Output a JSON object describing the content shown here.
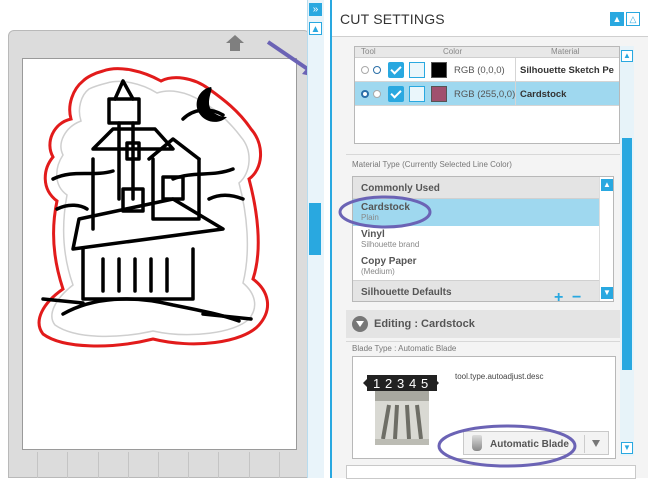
{
  "panel": {
    "title": "CUT SETTINGS",
    "icons": [
      "expand-icon",
      "collapse-icon"
    ]
  },
  "line_table": {
    "headers": {
      "tool": "Tool",
      "color": "Color",
      "material": "Material"
    },
    "rows": [
      {
        "rgb": "RGB (0,0,0)",
        "color": "#000000",
        "material": "Silhouette Sketch Pe",
        "selected": false
      },
      {
        "rgb": "RGB (255,0,0)",
        "color": "#a0506e",
        "material": "Cardstock",
        "selected": true
      }
    ]
  },
  "material_section": {
    "label": "Material Type (Currently Selected Line Color)",
    "groups": [
      {
        "title": "Commonly Used"
      }
    ],
    "items": [
      {
        "name": "Cardstock",
        "sub": "Plain",
        "selected": true
      },
      {
        "name": "Vinyl",
        "sub": "Silhouette brand",
        "selected": false
      },
      {
        "name": "Copy Paper",
        "sub": "(Medium)",
        "selected": false
      }
    ],
    "group2": "Silhouette Defaults",
    "add": "+",
    "remove": "−"
  },
  "editing": {
    "label": "Editing : Cardstock"
  },
  "blade": {
    "label": "Blade Type : Automatic Blade",
    "description": "tool.type.autoadjust.desc",
    "select_value": "Automatic Blade",
    "dial_numbers": [
      "1",
      "2",
      "3",
      "4",
      "5"
    ]
  },
  "colors": {
    "accent": "#29a8e0",
    "selected_row": "#9fd8ef",
    "annotation": "#6b63b5",
    "cut_line": "#e21b1b"
  }
}
